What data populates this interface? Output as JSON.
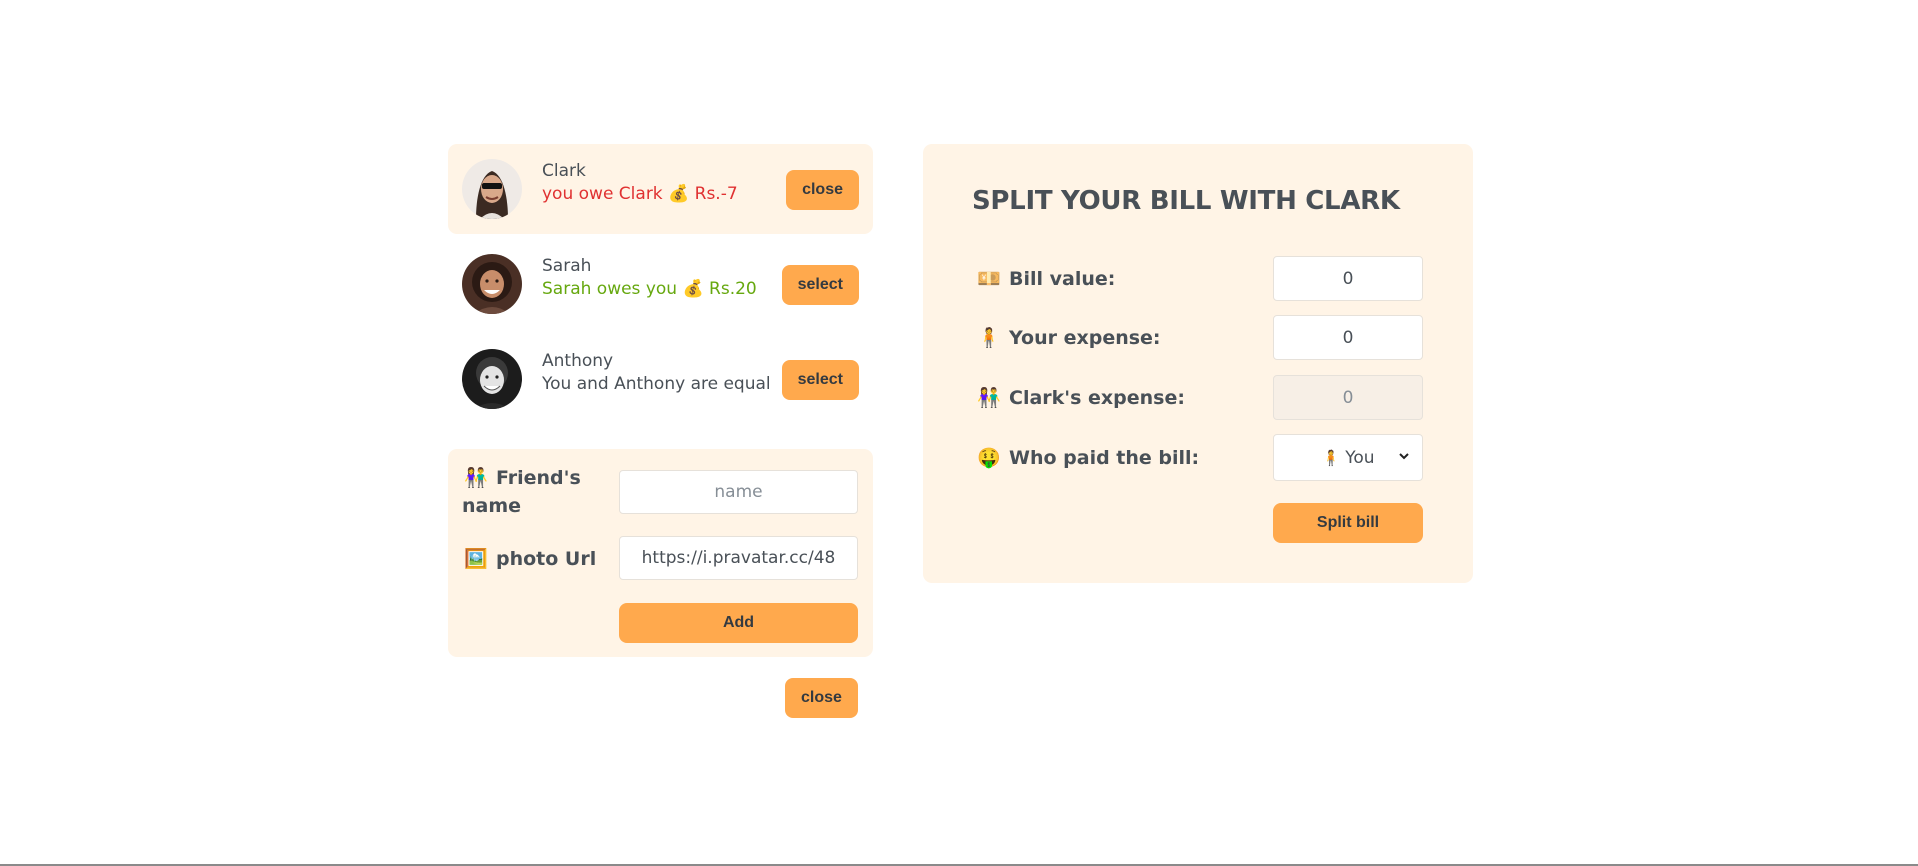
{
  "friends": [
    {
      "name": "Clark",
      "status": "you owe Clark 💰 Rs.-7",
      "status_tone": "negative",
      "button": "close",
      "selected": true
    },
    {
      "name": "Sarah",
      "status": "Sarah owes you 💰 Rs.20",
      "status_tone": "positive",
      "button": "select",
      "selected": false
    },
    {
      "name": "Anthony",
      "status": "You and Anthony are equal",
      "status_tone": "neutral",
      "button": "select",
      "selected": false
    }
  ],
  "add_friend": {
    "name_label_line1": "Friend's",
    "name_label_line2": "name",
    "name_placeholder": "name",
    "photo_label": "photo Url",
    "photo_value": "https://i.pravatar.cc/48",
    "add_button": "Add"
  },
  "close_form_button": "close",
  "split_bill": {
    "title": "SPLIT YOUR BILL WITH CLARK",
    "bill_label": "Bill value:",
    "bill_value": "0",
    "your_expense_label": "Your expense:",
    "your_expense_value": "0",
    "friend_expense_label": "Clark's expense:",
    "friend_expense_value": "0",
    "payer_label": "Who paid the bill:",
    "payer_selected": "You",
    "split_button": "Split bill"
  },
  "colors": {
    "accent": "#ffa94d",
    "panel": "#fff4e6",
    "negative": "#e03131",
    "positive": "#66a80f"
  },
  "icons": [
    "money-bag-icon",
    "banknote-icon",
    "person-icon",
    "people-icon",
    "money-face-icon",
    "picture-icon"
  ]
}
